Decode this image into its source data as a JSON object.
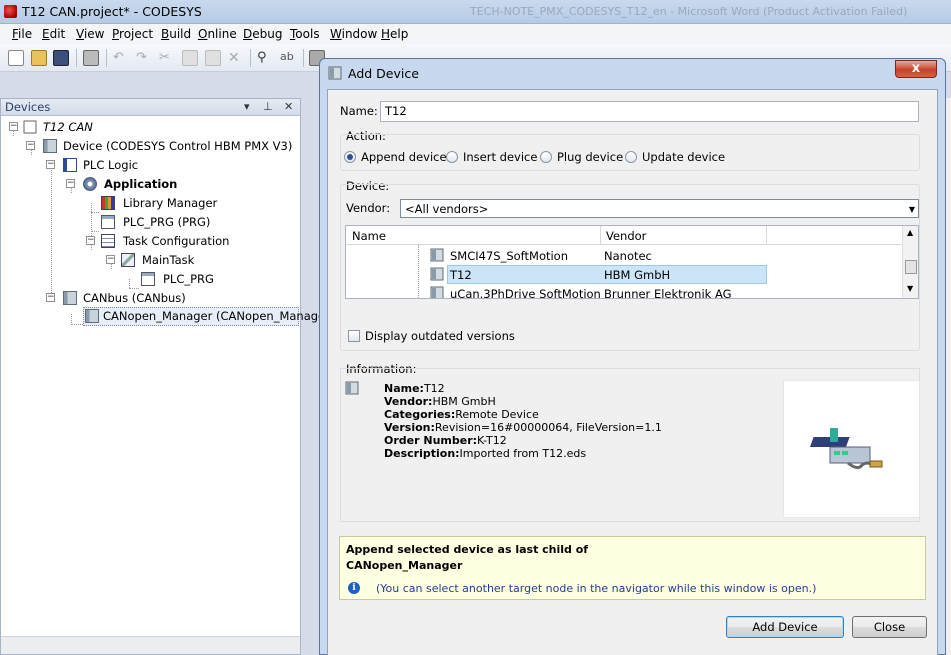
{
  "window": {
    "title": "T12 CAN.project* - CODESYS",
    "background_title": "TECH-NOTE_PMX_CODESYS_T12_en - Microsoft Word (Product Activation Failed)"
  },
  "menu": [
    "File",
    "Edit",
    "View",
    "Project",
    "Build",
    "Online",
    "Debug",
    "Tools",
    "Window",
    "Help"
  ],
  "devices_panel": {
    "title": "Devices",
    "tree": [
      {
        "label": "T12 CAN",
        "italic": true,
        "icon": "project-icon"
      },
      {
        "label": "Device (CODESYS Control HBM PMX V3)",
        "icon": "device-icon"
      },
      {
        "label": "PLC Logic",
        "icon": "plc-logic-icon"
      },
      {
        "label": "Application",
        "bold": true,
        "icon": "application-icon"
      },
      {
        "label": "Library Manager",
        "icon": "library-icon"
      },
      {
        "label": "PLC_PRG (PRG)",
        "icon": "program-icon"
      },
      {
        "label": "Task Configuration",
        "icon": "task-config-icon"
      },
      {
        "label": "MainTask",
        "icon": "task-icon"
      },
      {
        "label": "PLC_PRG",
        "icon": "program-icon"
      },
      {
        "label": "CANbus (CANbus)",
        "icon": "device-icon"
      },
      {
        "label": "CANopen_Manager (CANopen_Manager)",
        "icon": "device-icon",
        "selected": true
      }
    ]
  },
  "dialog": {
    "title": "Add Device",
    "close_label": "x",
    "name_label": "Name:",
    "name_value": "T12",
    "action_label": "Action:",
    "actions": [
      {
        "label": "Append device",
        "checked": true
      },
      {
        "label": "Insert device",
        "checked": false
      },
      {
        "label": "Plug device",
        "checked": false
      },
      {
        "label": "Update device",
        "checked": false
      }
    ],
    "device_label": "Device:",
    "vendor_label": "Vendor:",
    "vendor_value": "<All vendors>",
    "columns": [
      "Name",
      "Vendor"
    ],
    "rows": [
      {
        "name": "SMCI47S_SoftMotion",
        "vendor": "Nanotec"
      },
      {
        "name": "T12",
        "vendor": "HBM GmbH",
        "selected": true
      },
      {
        "name": "uCan.3PhDrive SoftMotion",
        "vendor": "Brunner Elektronik AG"
      }
    ],
    "display_outdated": "Display outdated versions",
    "information_label": "Information:",
    "info": [
      {
        "key": "Name:",
        "value": "T12"
      },
      {
        "key": "Vendor:",
        "value": "HBM GmbH"
      },
      {
        "key": "Categories:",
        "value": "Remote Device"
      },
      {
        "key": "Version:",
        "value": "Revision=16#00000064, FileVersion=1.1"
      },
      {
        "key": "Order Number:",
        "value": "K-T12"
      },
      {
        "key": "Description:",
        "value": "Imported from T12.eds"
      }
    ],
    "hint_line1": "Append selected device as last child of",
    "hint_line2": "CANopen_Manager",
    "hint_info": "(You can select another target node in the navigator while this window is open.)",
    "add_button": "Add Device",
    "close_button": "Close"
  }
}
